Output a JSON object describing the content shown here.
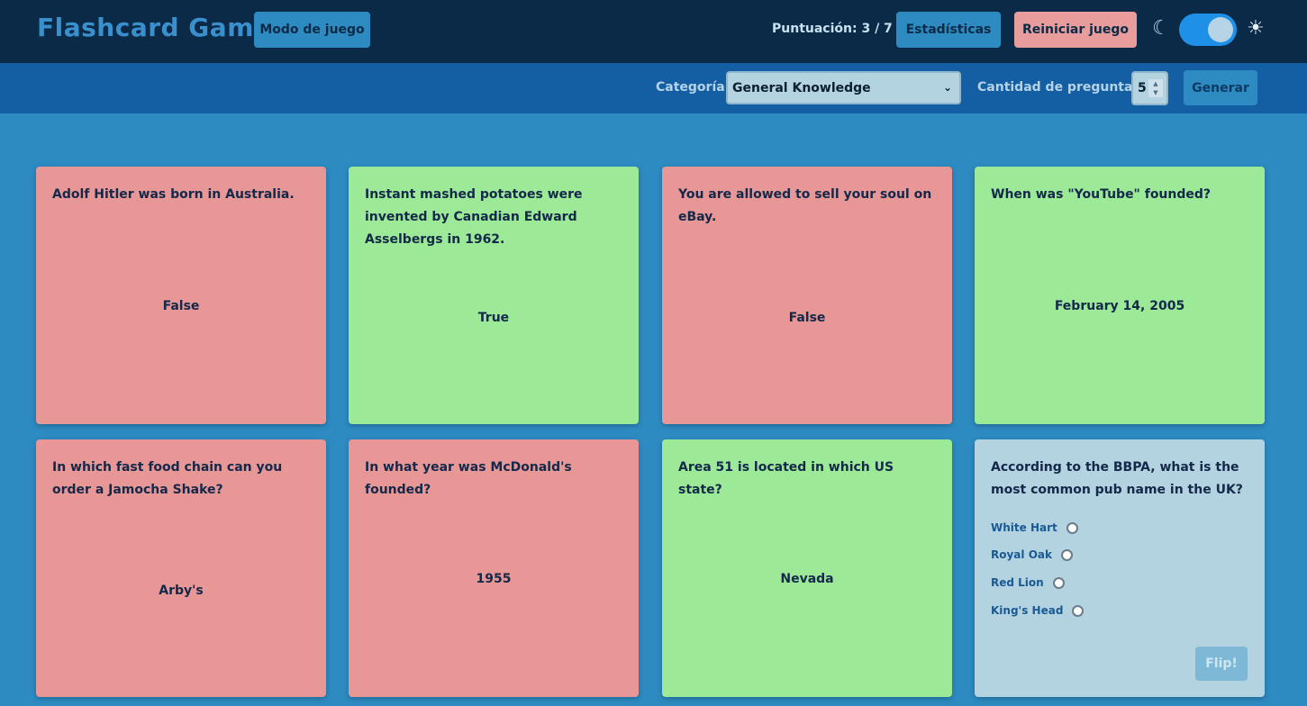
{
  "header": {
    "title": "Flashcard Game",
    "mode_label": "Modo de juego",
    "score_label": "Puntuación: 3 / 7",
    "stats_label": "Estadísticas",
    "reset_label": "Reiniciar juego",
    "theme_icon_dark": "moon-icon",
    "theme_icon_light": "sun-icon"
  },
  "controls": {
    "category_label": "Categoría",
    "category_value": "General Knowledge",
    "quantity_label": "Cantidad de preguntas",
    "quantity_value": "5",
    "generate_label": "Generar"
  },
  "colors": {
    "correct": "#9cea97",
    "incorrect": "#e89797",
    "pending": "#b3d3e0",
    "header_bg": "#0b2a47",
    "accent": "#2d8bc2"
  },
  "cards": [
    {
      "question": "Adolf Hitler was born in Australia.",
      "answer": "False",
      "status": "incorrect"
    },
    {
      "question": "Instant mashed potatoes were invented by Canadian Edward Asselbergs in 1962.",
      "answer": "True",
      "status": "correct"
    },
    {
      "question": "You are allowed to sell your soul on eBay.",
      "answer": "False",
      "status": "incorrect"
    },
    {
      "question": "When was \"YouTube\" founded?",
      "answer": "February 14, 2005",
      "status": "correct"
    },
    {
      "question": "In which fast food chain can you order a Jamocha Shake?",
      "answer": "Arby's",
      "status": "incorrect"
    },
    {
      "question": "In what year was McDonald's founded?",
      "answer": "1955",
      "status": "incorrect"
    },
    {
      "question": "Area 51 is located in which US state?",
      "answer": "Nevada",
      "status": "correct"
    },
    {
      "question": "According to the BBPA, what is the most common pub name in the UK?",
      "status": "pending",
      "options": [
        "White Hart",
        "Royal Oak",
        "Red Lion",
        "King's Head"
      ],
      "flip_label": "Flip!"
    }
  ]
}
